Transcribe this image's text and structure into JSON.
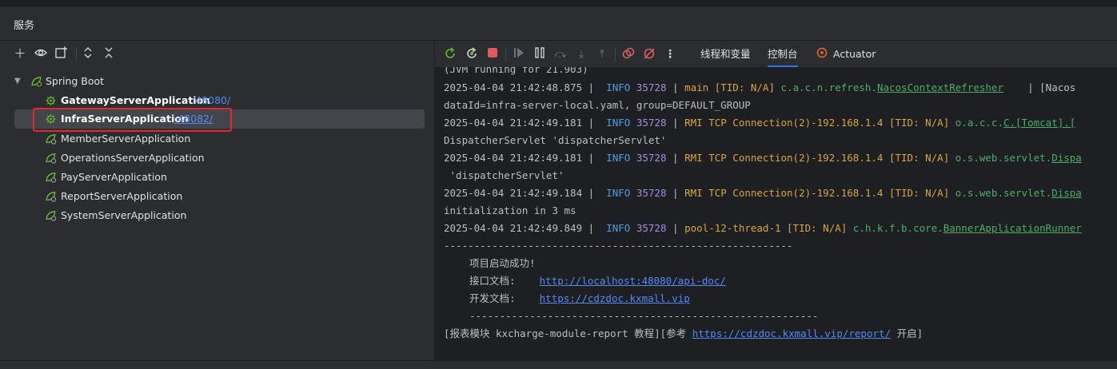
{
  "panel_title": "服务",
  "tree": {
    "root_label": "Spring Boot",
    "apps": [
      {
        "name": "GatewayServerApplication",
        "port": ":48080/"
      },
      {
        "name": "InfraServerApplication",
        "port": ":48082/"
      },
      {
        "name": "MemberServerApplication",
        "port": ""
      },
      {
        "name": "OperationsServerApplication",
        "port": ""
      },
      {
        "name": "PayServerApplication",
        "port": ""
      },
      {
        "name": "ReportServerApplication",
        "port": ""
      },
      {
        "name": "SystemServerApplication",
        "port": ""
      }
    ]
  },
  "tabs": {
    "threads_vars": "线程和变量",
    "console": "控制台",
    "actuator": "Actuator"
  },
  "console": {
    "partial_top": "(JVM running for 21.903)",
    "logs": [
      {
        "ts": "2025-04-04 21:42:48.875 |",
        "level": "INFO",
        "pid": "35728",
        "sep": "|",
        "thread": "main [TID: N/A]",
        "logger_prefix": "c.a.c.n.refresh.",
        "logger_main": "NacosContextRefresher",
        "tail": "    | [Nacos",
        "cont": "dataId=infra-server-local.yaml, group=DEFAULT_GROUP"
      },
      {
        "ts": "2025-04-04 21:42:49.181 |",
        "level": "INFO",
        "pid": "35728",
        "sep": "|",
        "thread": "RMI TCP Connection(2)-192.168.1.4 [TID: N/A]",
        "logger_prefix": "o.a.c.c.",
        "logger_main": "C.[Tomcat].[",
        "tail": "",
        "cont": "DispatcherServlet 'dispatcherServlet'"
      },
      {
        "ts": "2025-04-04 21:42:49.181 |",
        "level": "INFO",
        "pid": "35728",
        "sep": "|",
        "thread": "RMI TCP Connection(2)-192.168.1.4 [TID: N/A]",
        "logger_prefix": "o.s.web.servlet.",
        "logger_main": "Dispa",
        "tail": "",
        "cont": " 'dispatcherServlet'"
      },
      {
        "ts": "2025-04-04 21:42:49.184 |",
        "level": "INFO",
        "pid": "35728",
        "sep": "|",
        "thread": "RMI TCP Connection(2)-192.168.1.4 [TID: N/A]",
        "logger_prefix": "o.s.web.servlet.",
        "logger_main": "Dispa",
        "tail": "",
        "cont": "initialization in 3 ms"
      },
      {
        "ts": "2025-04-04 21:42:49.849 |",
        "level": "INFO",
        "pid": "35728",
        "sep": "|",
        "thread": "pool-12-thread-1 [TID: N/A]",
        "logger_prefix": "c.h.k.f.b.core.",
        "logger_main": "BannerApplicationRunner",
        "tail": "",
        "cont": ""
      }
    ],
    "divider1": "----------------------------------------------------------",
    "banner_success": "项目启动成功!",
    "api_doc_label": "接口文档:",
    "api_doc_url": "http://localhost:48080/api-doc/",
    "dev_doc_label": "开发文档:",
    "dev_doc_url": "https://cdzdoc.kxmall.vip",
    "divider2": "----------------------------------------------------------",
    "report_prefix": "[报表模块 kxcharge-module-report 教程][参考 ",
    "report_url": "https://cdzdoc.kxmall.vip/report/",
    "report_suffix": " 开启]"
  }
}
